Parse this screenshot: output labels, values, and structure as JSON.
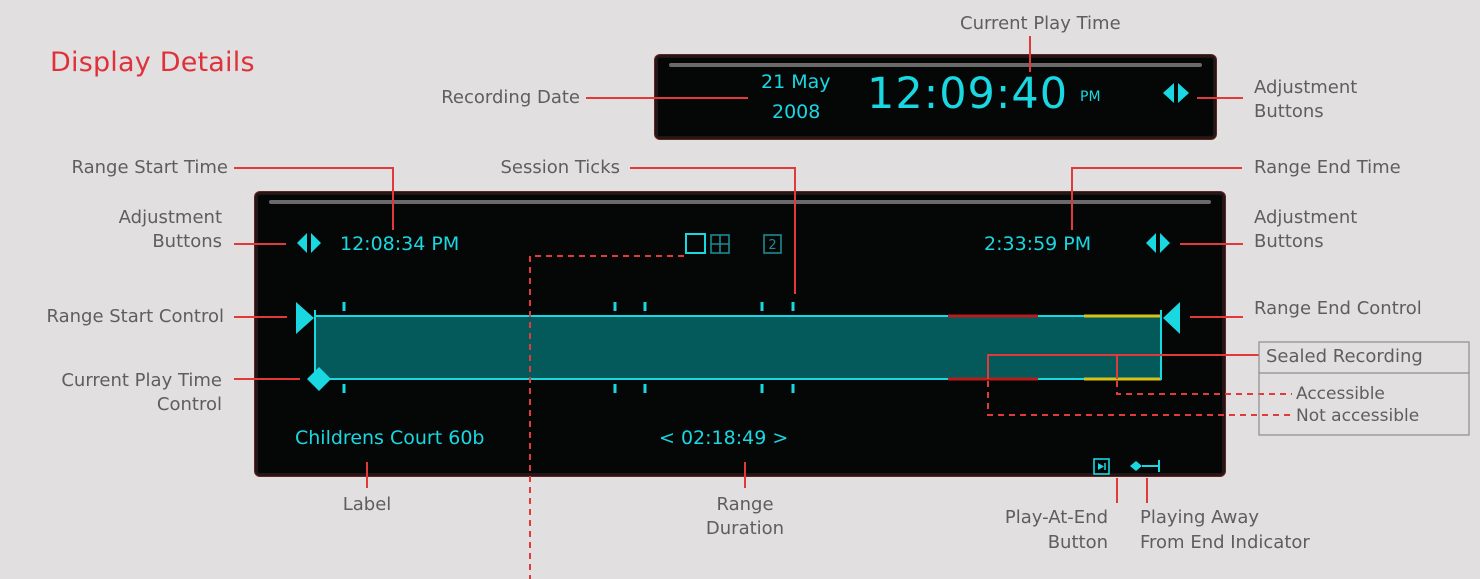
{
  "title": "Display Details",
  "top_display": {
    "date_day": "21 May",
    "date_year": "2008",
    "time": "12:09:40",
    "ampm": "PM"
  },
  "main_display": {
    "range_start_time": "12:08:34 PM",
    "range_end_time": "2:33:59 PM",
    "label": "Childrens Court 60b",
    "duration": "< 02:18:49 >",
    "view_icon_single": "single-view-icon",
    "view_icon_quad": "quad-view-icon",
    "view_icon_two": "2"
  },
  "callouts": {
    "current_play_time": "Current Play Time",
    "recording_date": "Recording Date",
    "adjustment_top_1": "Adjustment",
    "adjustment_top_2": "Buttons",
    "range_start_time": "Range Start Time",
    "session_ticks": "Session Ticks",
    "range_end_time": "Range End Time",
    "adjustment_left_1": "Adjustment",
    "adjustment_left_2": "Buttons",
    "adjustment_right_1": "Adjustment",
    "adjustment_right_2": "Buttons",
    "range_start_control": "Range Start Control",
    "range_end_control": "Range End Control",
    "current_play_time_control_1": "Current Play Time",
    "current_play_time_control_2": "Control",
    "sealed_recording": "Sealed Recording",
    "accessible": "Accessible",
    "not_accessible": "Not accessible",
    "label": "Label",
    "range_duration_1": "Range",
    "range_duration_2": "Duration",
    "play_at_end_1": "Play-At-End",
    "play_at_end_2": "Button",
    "playing_away_1": "Playing Away",
    "playing_away_2": "From End Indicator"
  },
  "colors": {
    "background": "#e1dfdf",
    "title_red": "#e0313a",
    "callout_line": "#e23a3a",
    "cyan": "#19d8e2",
    "bar_fill": "#045a5a",
    "sealed_not_accessible": "#b81c1c",
    "sealed_accessible": "#d6c21a"
  }
}
